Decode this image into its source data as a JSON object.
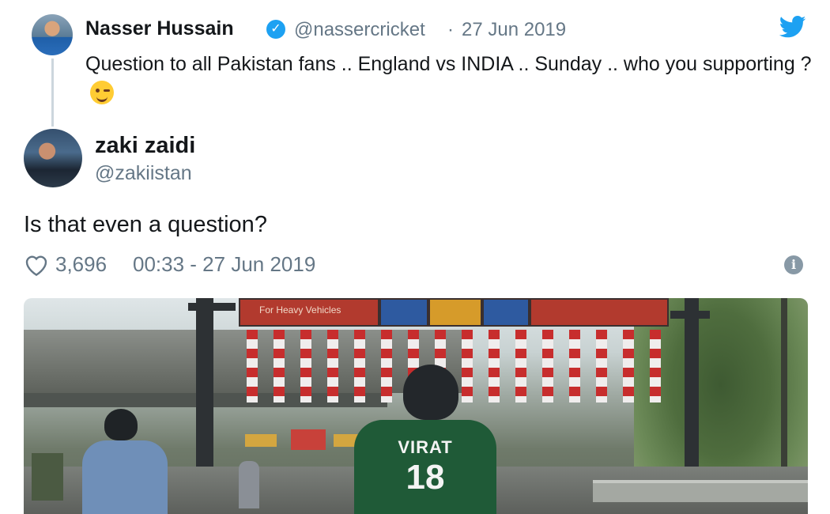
{
  "original_tweet": {
    "name": "Nasser Hussain",
    "handle": "@nassercricket",
    "separator": "·",
    "date": "27 Jun 2019",
    "text": "Question to all Pakistan fans .. England vs INDIA .. Sunday .. who you supporting ?",
    "icons": [
      "verified-icon",
      "twitter-bird-icon",
      "winking-face-emoji-icon"
    ]
  },
  "reply_tweet": {
    "name": "zaki zaidi",
    "handle": "@zakiistan",
    "text": "Is that even a question?",
    "likes": "3,696",
    "timestamp": "00:33 - 27 Jun 2019",
    "icons": [
      "heart-icon",
      "info-icon"
    ]
  },
  "photo": {
    "board_text": "For Heavy Vehicles",
    "jersey_name": "VIRAT",
    "jersey_number": "18"
  },
  "colors": {
    "twitter_blue": "#1da1f2",
    "secondary_text": "#657786",
    "primary_text": "#14171a",
    "jersey_green": "#1f5a37"
  }
}
